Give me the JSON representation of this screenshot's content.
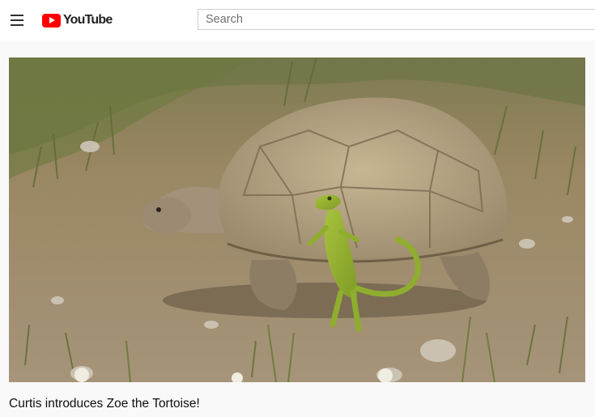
{
  "header": {
    "menu_icon": "hamburger-menu-icon",
    "logo_text": "YouTube",
    "logo_icon": "youtube-play-icon",
    "brand_color": "#ff0000"
  },
  "search": {
    "placeholder": "Search",
    "value": ""
  },
  "video": {
    "title": "Curtis introduces Zoe the Tortoise!"
  }
}
